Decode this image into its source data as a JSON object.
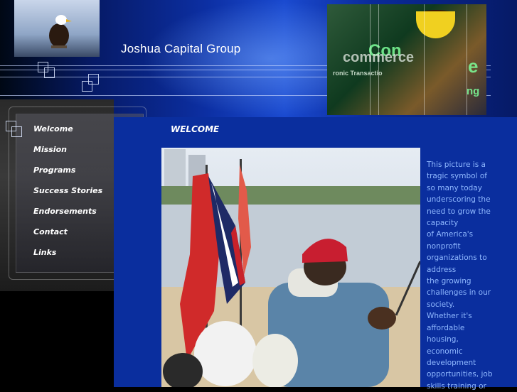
{
  "header": {
    "company_name": "Joshua Capital Group",
    "colors": {
      "bg_blue": "#0c2fa3",
      "accent": "#ffffff"
    }
  },
  "collage": {
    "words": [
      "Con",
      "commerce",
      "ronic Transactio",
      "e",
      "ng"
    ]
  },
  "nav": {
    "items": [
      {
        "label": "Welcome"
      },
      {
        "label": "Mission"
      },
      {
        "label": "Programs"
      },
      {
        "label": "Success Stories"
      },
      {
        "label": "Endorsements"
      },
      {
        "label": "Contact"
      },
      {
        "label": "Links"
      }
    ]
  },
  "main": {
    "title": "WELCOME",
    "caption_lines": [
      "This picture is a",
      "tragic symbol of",
      "so many today",
      "underscoring the",
      "need to grow the",
      "capacity",
      "of America's",
      "nonprofit",
      "organizations to",
      "address",
      "the growing",
      "challenges in our",
      "society.",
      "Whether it's",
      "affordable",
      "housing,",
      "economic",
      "development",
      "opportunities, job",
      "skills training or"
    ],
    "caption_color": "#8fb8ff"
  }
}
